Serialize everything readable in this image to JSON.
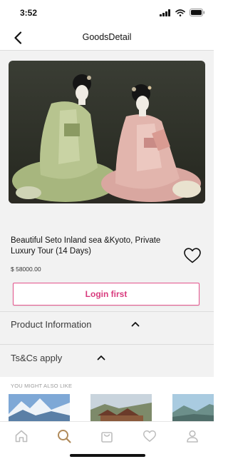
{
  "status_bar": {
    "time": "3:52",
    "icons": [
      "signal-icon",
      "wifi-icon",
      "battery-icon"
    ]
  },
  "header": {
    "title": "GoodsDetail",
    "back_icon": "chevron-left-icon"
  },
  "product": {
    "title": "Beautiful Seto Inland sea &Kyoto, Private Luxury Tour (14 Days)",
    "price": "$ 58000.00",
    "favorite_icon": "heart-outline-icon"
  },
  "actions": {
    "login_label": "Login first"
  },
  "sections": [
    {
      "label": "Product Information",
      "icon": "chevron-up-icon"
    },
    {
      "label": "Ts&Cs apply",
      "icon": "chevron-up-icon"
    }
  ],
  "recommendations": {
    "title": "YOU MIGHT ALSO LIKE"
  },
  "tabbar": {
    "active": "search",
    "items": [
      "home-icon",
      "search-icon",
      "bag-icon",
      "heart-icon",
      "user-icon"
    ]
  },
  "colors": {
    "accent": "#d83a7d",
    "accent_border": "#e4538c",
    "active_tab": "#b08a5a",
    "inactive_tab": "#bdbdbd"
  }
}
